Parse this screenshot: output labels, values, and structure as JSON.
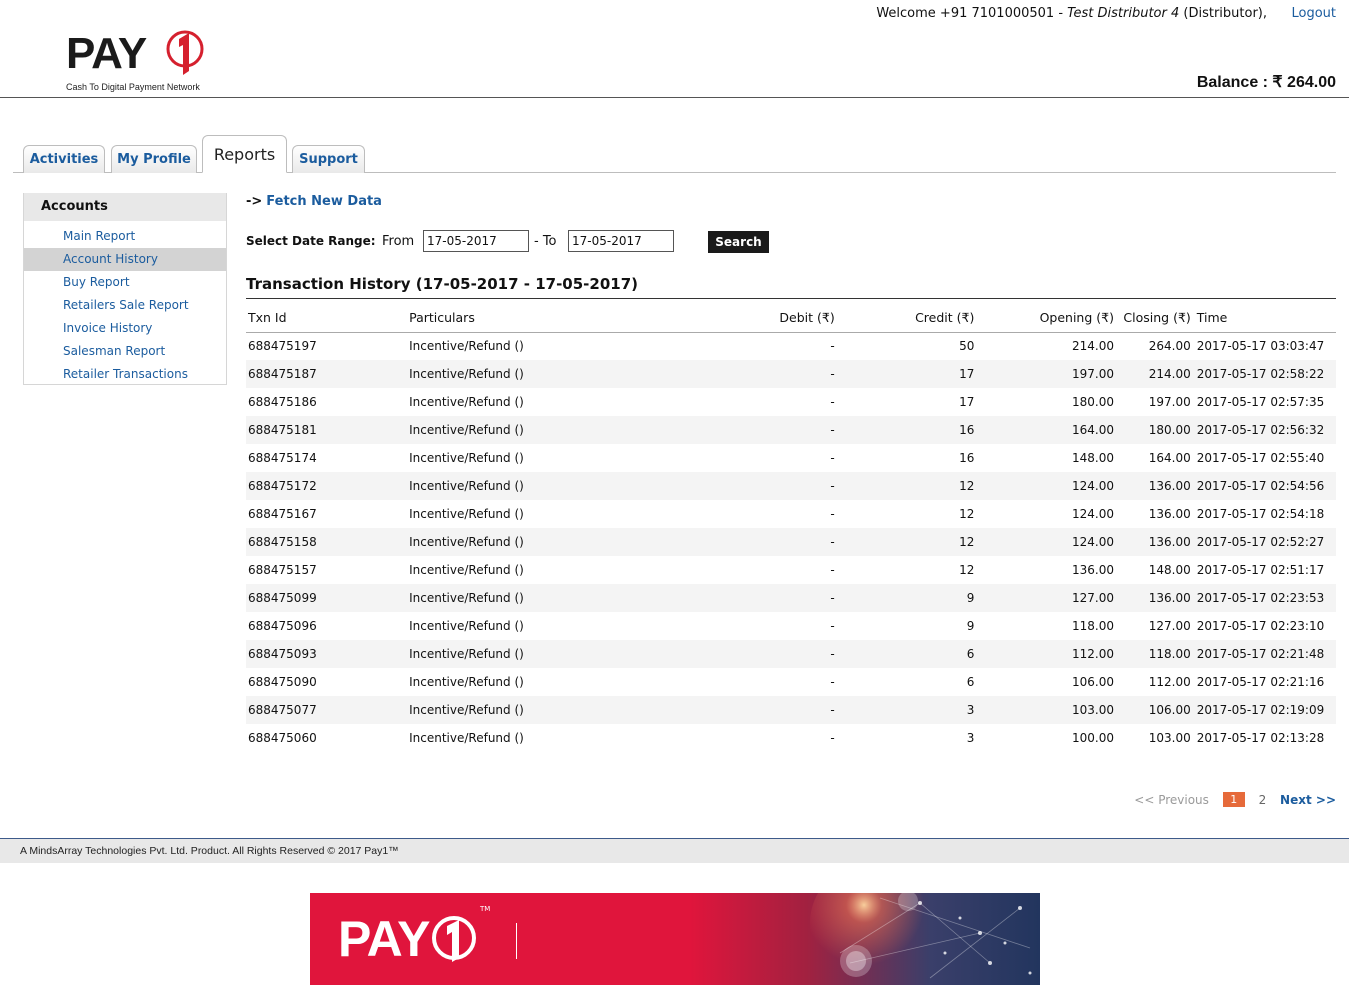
{
  "header": {
    "logo_text": "PAY1",
    "logo_tagline": "Cash To Digital Payment Network",
    "welcome_prefix": "Welcome +91 7101000501 - ",
    "user_name": "Test Distributor 4",
    "user_role": " (Distributor),",
    "logout_label": "Logout",
    "balance_label": "Balance : ₹ 264.00"
  },
  "tabs": [
    {
      "label": "Activities"
    },
    {
      "label": "My Profile"
    },
    {
      "label": "Reports"
    },
    {
      "label": "Support"
    }
  ],
  "sidebar": {
    "heading": "Accounts",
    "items": [
      {
        "label": "Main Report"
      },
      {
        "label": "Account History"
      },
      {
        "label": "Buy Report"
      },
      {
        "label": "Retailers Sale Report"
      },
      {
        "label": "Invoice History"
      },
      {
        "label": "Salesman Report"
      },
      {
        "label": "Retailer Transactions"
      }
    ]
  },
  "main": {
    "fetch_arrow": "->",
    "fetch_label": "Fetch New Data",
    "date_range_label": "Select Date Range:",
    "from_label": "From",
    "from_value": "17-05-2017",
    "to_label": "- To",
    "to_value": "17-05-2017",
    "search_label": "Search",
    "table_title": "Transaction History (17-05-2017 - 17-05-2017)"
  },
  "table": {
    "headers": [
      "Txn Id",
      "Particulars",
      "Debit (₹)",
      "Credit (₹)",
      "Opening (₹)",
      "Closing (₹)",
      "Time"
    ],
    "rows": [
      [
        "688475197",
        "Incentive/Refund ()",
        "-",
        "50",
        "214.00",
        "264.00",
        "2017-05-17 03:03:47"
      ],
      [
        "688475187",
        "Incentive/Refund ()",
        "-",
        "17",
        "197.00",
        "214.00",
        "2017-05-17 02:58:22"
      ],
      [
        "688475186",
        "Incentive/Refund ()",
        "-",
        "17",
        "180.00",
        "197.00",
        "2017-05-17 02:57:35"
      ],
      [
        "688475181",
        "Incentive/Refund ()",
        "-",
        "16",
        "164.00",
        "180.00",
        "2017-05-17 02:56:32"
      ],
      [
        "688475174",
        "Incentive/Refund ()",
        "-",
        "16",
        "148.00",
        "164.00",
        "2017-05-17 02:55:40"
      ],
      [
        "688475172",
        "Incentive/Refund ()",
        "-",
        "12",
        "124.00",
        "136.00",
        "2017-05-17 02:54:56"
      ],
      [
        "688475167",
        "Incentive/Refund ()",
        "-",
        "12",
        "124.00",
        "136.00",
        "2017-05-17 02:54:18"
      ],
      [
        "688475158",
        "Incentive/Refund ()",
        "-",
        "12",
        "124.00",
        "136.00",
        "2017-05-17 02:52:27"
      ],
      [
        "688475157",
        "Incentive/Refund ()",
        "-",
        "12",
        "136.00",
        "148.00",
        "2017-05-17 02:51:17"
      ],
      [
        "688475099",
        "Incentive/Refund ()",
        "-",
        "9",
        "127.00",
        "136.00",
        "2017-05-17 02:23:53"
      ],
      [
        "688475096",
        "Incentive/Refund ()",
        "-",
        "9",
        "118.00",
        "127.00",
        "2017-05-17 02:23:10"
      ],
      [
        "688475093",
        "Incentive/Refund ()",
        "-",
        "6",
        "112.00",
        "118.00",
        "2017-05-17 02:21:48"
      ],
      [
        "688475090",
        "Incentive/Refund ()",
        "-",
        "6",
        "106.00",
        "112.00",
        "2017-05-17 02:21:16"
      ],
      [
        "688475077",
        "Incentive/Refund ()",
        "-",
        "3",
        "103.00",
        "106.00",
        "2017-05-17 02:19:09"
      ],
      [
        "688475060",
        "Incentive/Refund ()",
        "-",
        "3",
        "100.00",
        "103.00",
        "2017-05-17 02:13:28"
      ]
    ]
  },
  "pagination": {
    "prev_label": "<< Previous",
    "current": "1",
    "next_page": "2",
    "next_label": "Next >>"
  },
  "footer": {
    "text": "A MindsArray Technologies Pvt. Ltd. Product. All Rights Reserved © 2017 Pay1™"
  },
  "banner": {
    "logo_text": "PAY1",
    "tm": "TM"
  },
  "colors": {
    "link": "#1b5c9e",
    "brand_red": "#e0153c",
    "pager_current": "#e66a3a"
  },
  "icons": {
    "logo": "pay1-logo",
    "currency": "rupee-sign"
  }
}
